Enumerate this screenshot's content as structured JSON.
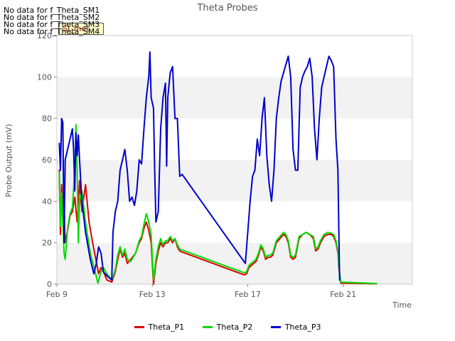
{
  "chart_data": {
    "type": "line",
    "title": "Theta Probes",
    "xlabel": "Time",
    "ylabel": "Probe Output (mV)",
    "ylim": [
      0,
      120
    ],
    "y_ticks": [
      0,
      20,
      40,
      60,
      80,
      100,
      120
    ],
    "x_ticks": [
      {
        "label": "Feb 9",
        "day": 9
      },
      {
        "label": "Feb 13",
        "day": 13
      },
      {
        "label": "Feb 17",
        "day": 17
      },
      {
        "label": "Feb 21",
        "day": 21
      }
    ],
    "xlim_days": [
      9,
      23.9
    ],
    "grid": "horizontal bands",
    "legend_position": "bottom",
    "no_data_messages": [
      "No data for f_Theta_SM1",
      "No data for f_Theta_SM2",
      "No data for f_Theta_SM3",
      "No data for f_Theta_SM4"
    ],
    "badge": "SI_met",
    "series": [
      {
        "name": "Theta_P1",
        "color": "#dd0000",
        "points": [
          [
            9.1,
            55
          ],
          [
            9.15,
            24
          ],
          [
            9.2,
            48
          ],
          [
            9.25,
            35
          ],
          [
            9.3,
            40
          ],
          [
            9.35,
            20
          ],
          [
            9.45,
            26
          ],
          [
            9.55,
            33
          ],
          [
            9.65,
            35
          ],
          [
            9.75,
            42
          ],
          [
            9.85,
            30
          ],
          [
            9.95,
            50
          ],
          [
            10.05,
            35
          ],
          [
            10.2,
            48
          ],
          [
            10.35,
            30
          ],
          [
            10.5,
            20
          ],
          [
            10.75,
            5
          ],
          [
            10.85,
            8
          ],
          [
            10.95,
            6
          ],
          [
            11.1,
            2
          ],
          [
            11.3,
            1
          ],
          [
            11.45,
            6
          ],
          [
            11.55,
            12
          ],
          [
            11.65,
            17
          ],
          [
            11.75,
            13
          ],
          [
            11.85,
            15
          ],
          [
            11.95,
            10
          ],
          [
            12.1,
            12
          ],
          [
            12.3,
            15
          ],
          [
            12.45,
            20
          ],
          [
            12.55,
            22
          ],
          [
            12.65,
            27
          ],
          [
            12.75,
            30
          ],
          [
            12.85,
            26
          ],
          [
            12.95,
            20
          ],
          [
            13.05,
            0
          ],
          [
            13.15,
            10
          ],
          [
            13.25,
            16
          ],
          [
            13.35,
            20
          ],
          [
            13.45,
            18
          ],
          [
            13.55,
            20
          ],
          [
            13.65,
            20
          ],
          [
            13.75,
            22
          ],
          [
            13.85,
            20
          ],
          [
            13.95,
            22
          ],
          [
            14.05,
            18
          ],
          [
            14.15,
            16
          ],
          [
            14.25,
            15.5
          ],
          [
            16.85,
            4.5
          ],
          [
            16.95,
            5
          ],
          [
            17.05,
            8
          ],
          [
            17.15,
            9
          ],
          [
            17.25,
            10
          ],
          [
            17.35,
            11
          ],
          [
            17.45,
            14
          ],
          [
            17.55,
            18
          ],
          [
            17.65,
            16
          ],
          [
            17.75,
            12
          ],
          [
            17.85,
            13
          ],
          [
            17.95,
            13
          ],
          [
            18.05,
            14
          ],
          [
            18.2,
            20
          ],
          [
            18.35,
            22
          ],
          [
            18.5,
            24
          ],
          [
            18.6,
            23
          ],
          [
            18.7,
            20
          ],
          [
            18.8,
            13
          ],
          [
            18.9,
            12
          ],
          [
            19.0,
            13
          ],
          [
            19.15,
            22
          ],
          [
            19.3,
            24
          ],
          [
            19.45,
            25
          ],
          [
            19.6,
            24
          ],
          [
            19.75,
            22
          ],
          [
            19.85,
            16
          ],
          [
            19.95,
            17
          ],
          [
            20.05,
            20
          ],
          [
            20.2,
            23
          ],
          [
            20.35,
            24
          ],
          [
            20.5,
            24
          ],
          [
            20.6,
            23
          ],
          [
            20.7,
            20
          ],
          [
            20.78,
            15
          ],
          [
            20.82,
            8
          ],
          [
            20.9,
            0.5
          ],
          [
            22.4,
            0.2
          ]
        ]
      },
      {
        "name": "Theta_P2",
        "color": "#00dd00",
        "points": [
          [
            9.1,
            54
          ],
          [
            9.15,
            28
          ],
          [
            9.2,
            44
          ],
          [
            9.25,
            30
          ],
          [
            9.3,
            15
          ],
          [
            9.35,
            12
          ],
          [
            9.45,
            27
          ],
          [
            9.55,
            34
          ],
          [
            9.65,
            37
          ],
          [
            9.75,
            55
          ],
          [
            9.8,
            77
          ],
          [
            9.85,
            55
          ],
          [
            9.9,
            20
          ],
          [
            9.95,
            40
          ],
          [
            10.05,
            45
          ],
          [
            10.2,
            30
          ],
          [
            10.4,
            15
          ],
          [
            10.6,
            6
          ],
          [
            10.72,
            0.5
          ],
          [
            10.85,
            6
          ],
          [
            10.95,
            8
          ],
          [
            11.1,
            5
          ],
          [
            11.3,
            2
          ],
          [
            11.45,
            7
          ],
          [
            11.55,
            14
          ],
          [
            11.65,
            18
          ],
          [
            11.75,
            14
          ],
          [
            11.85,
            17
          ],
          [
            11.95,
            12
          ],
          [
            12.1,
            11
          ],
          [
            12.3,
            15
          ],
          [
            12.45,
            21
          ],
          [
            12.55,
            23
          ],
          [
            12.65,
            29
          ],
          [
            12.75,
            34
          ],
          [
            12.85,
            30
          ],
          [
            12.95,
            24
          ],
          [
            13.05,
            2
          ],
          [
            13.15,
            12
          ],
          [
            13.25,
            18
          ],
          [
            13.35,
            22
          ],
          [
            13.45,
            19
          ],
          [
            13.55,
            21
          ],
          [
            13.65,
            21
          ],
          [
            13.75,
            23
          ],
          [
            13.85,
            21
          ],
          [
            13.95,
            22
          ],
          [
            14.05,
            19
          ],
          [
            14.15,
            17
          ],
          [
            14.25,
            16.5
          ],
          [
            16.85,
            5.5
          ],
          [
            16.95,
            6
          ],
          [
            17.05,
            9
          ],
          [
            17.15,
            10
          ],
          [
            17.25,
            11
          ],
          [
            17.35,
            12
          ],
          [
            17.45,
            15
          ],
          [
            17.55,
            19
          ],
          [
            17.65,
            17
          ],
          [
            17.75,
            13
          ],
          [
            17.85,
            14
          ],
          [
            17.95,
            14
          ],
          [
            18.05,
            15
          ],
          [
            18.2,
            21
          ],
          [
            18.35,
            23
          ],
          [
            18.5,
            25
          ],
          [
            18.6,
            24
          ],
          [
            18.7,
            21
          ],
          [
            18.8,
            14
          ],
          [
            18.9,
            13
          ],
          [
            19.0,
            14
          ],
          [
            19.15,
            23
          ],
          [
            19.3,
            24
          ],
          [
            19.45,
            25
          ],
          [
            19.6,
            24
          ],
          [
            19.75,
            23
          ],
          [
            19.85,
            17
          ],
          [
            19.95,
            18
          ],
          [
            20.05,
            21
          ],
          [
            20.2,
            24
          ],
          [
            20.35,
            25
          ],
          [
            20.5,
            24.5
          ],
          [
            20.6,
            24
          ],
          [
            20.7,
            21
          ],
          [
            20.78,
            16
          ],
          [
            20.82,
            9
          ],
          [
            20.9,
            1
          ],
          [
            22.4,
            0.3
          ]
        ]
      },
      {
        "name": "Theta_P3",
        "color": "#0000cc",
        "points": [
          [
            9.1,
            68
          ],
          [
            9.15,
            55
          ],
          [
            9.2,
            80
          ],
          [
            9.25,
            78
          ],
          [
            9.3,
            20
          ],
          [
            9.35,
            60
          ],
          [
            9.45,
            65
          ],
          [
            9.55,
            70
          ],
          [
            9.65,
            75
          ],
          [
            9.7,
            65
          ],
          [
            9.75,
            45
          ],
          [
            9.8,
            73
          ],
          [
            9.85,
            62
          ],
          [
            9.9,
            72
          ],
          [
            9.95,
            60
          ],
          [
            10.05,
            40
          ],
          [
            10.2,
            25
          ],
          [
            10.4,
            12
          ],
          [
            10.55,
            5
          ],
          [
            10.65,
            10
          ],
          [
            10.75,
            18
          ],
          [
            10.85,
            15
          ],
          [
            10.95,
            6
          ],
          [
            11.1,
            4
          ],
          [
            11.3,
            2
          ],
          [
            11.35,
            25
          ],
          [
            11.45,
            35
          ],
          [
            11.55,
            40
          ],
          [
            11.65,
            55
          ],
          [
            11.75,
            60
          ],
          [
            11.85,
            65
          ],
          [
            11.95,
            55
          ],
          [
            12.05,
            40
          ],
          [
            12.15,
            42
          ],
          [
            12.25,
            38
          ],
          [
            12.35,
            45
          ],
          [
            12.45,
            60
          ],
          [
            12.55,
            58
          ],
          [
            12.65,
            75
          ],
          [
            12.75,
            90
          ],
          [
            12.85,
            100
          ],
          [
            12.9,
            112
          ],
          [
            12.95,
            90
          ],
          [
            13.05,
            85
          ],
          [
            13.1,
            55
          ],
          [
            13.15,
            30
          ],
          [
            13.25,
            35
          ],
          [
            13.35,
            75
          ],
          [
            13.45,
            90
          ],
          [
            13.55,
            97
          ],
          [
            13.6,
            57
          ],
          [
            13.65,
            90
          ],
          [
            13.75,
            102
          ],
          [
            13.85,
            105
          ],
          [
            13.95,
            80
          ],
          [
            14.05,
            80
          ],
          [
            14.15,
            52
          ],
          [
            14.25,
            53
          ],
          [
            16.9,
            10
          ],
          [
            17.0,
            25
          ],
          [
            17.1,
            40
          ],
          [
            17.2,
            52
          ],
          [
            17.3,
            55
          ],
          [
            17.4,
            70
          ],
          [
            17.5,
            62
          ],
          [
            17.6,
            80
          ],
          [
            17.7,
            90
          ],
          [
            17.8,
            62
          ],
          [
            17.9,
            48
          ],
          [
            18.0,
            40
          ],
          [
            18.1,
            55
          ],
          [
            18.2,
            80
          ],
          [
            18.3,
            90
          ],
          [
            18.4,
            98
          ],
          [
            18.5,
            102
          ],
          [
            18.6,
            106
          ],
          [
            18.7,
            110
          ],
          [
            18.8,
            100
          ],
          [
            18.9,
            65
          ],
          [
            19.0,
            55
          ],
          [
            19.1,
            55
          ],
          [
            19.2,
            95
          ],
          [
            19.3,
            100
          ],
          [
            19.4,
            103
          ],
          [
            19.5,
            105
          ],
          [
            19.6,
            109
          ],
          [
            19.7,
            100
          ],
          [
            19.8,
            75
          ],
          [
            19.9,
            60
          ],
          [
            20.0,
            80
          ],
          [
            20.1,
            95
          ],
          [
            20.2,
            100
          ],
          [
            20.3,
            105
          ],
          [
            20.4,
            110
          ],
          [
            20.5,
            108
          ],
          [
            20.6,
            105
          ],
          [
            20.7,
            70
          ],
          [
            20.78,
            55
          ],
          [
            20.85,
            2
          ]
        ]
      }
    ]
  }
}
